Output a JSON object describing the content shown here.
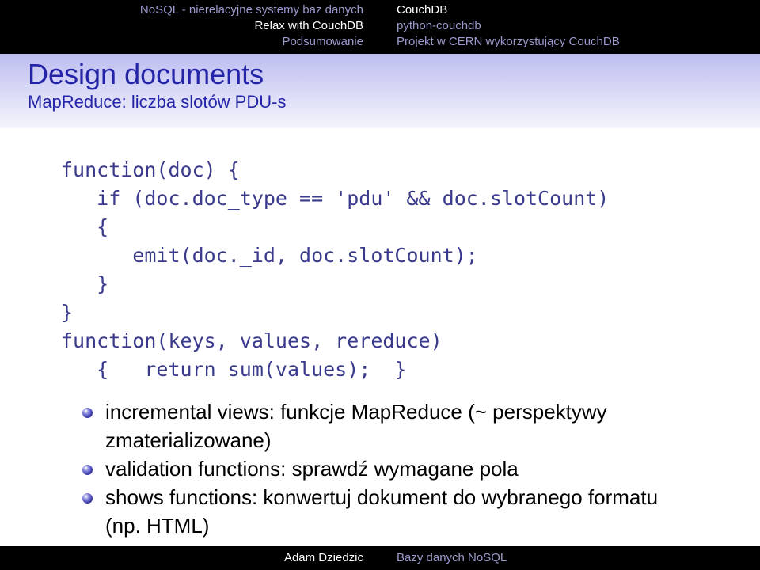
{
  "header": {
    "sections": [
      {
        "label": "NoSQL - nierelacyjne systemy baz danych",
        "active": false
      },
      {
        "label": "Relax with CouchDB",
        "active": true
      },
      {
        "label": "Podsumowanie",
        "active": false
      }
    ],
    "subsections": [
      {
        "label": "CouchDB",
        "active": true
      },
      {
        "label": "python-couchdb",
        "active": false
      },
      {
        "label": "Projekt w CERN wykorzystujący CouchDB",
        "active": false
      }
    ]
  },
  "frame": {
    "title": "Design documents",
    "subtitle": "MapReduce: liczba slotów PDU-s"
  },
  "code": {
    "lines": [
      "function(doc) {",
      "   if (doc.doc_type == 'pdu' && doc.slotCount)",
      "   {",
      "      emit(doc._id, doc.slotCount);",
      "   }",
      "}",
      "function(keys, values, rereduce)",
      "   {   return sum(values);  }"
    ]
  },
  "bullets": [
    "incremental views: funkcje MapReduce (~ perspektywy zmaterializowane)",
    "validation functions: sprawdź wymagane pola",
    "shows functions: konwertuj dokument do wybranego formatu (np. HTML)"
  ],
  "footer": {
    "author": "Adam Dziedzic",
    "title": "Bazy danych NoSQL"
  },
  "colors": {
    "header_background": "#000000",
    "title_text": "#2424a8",
    "code_text": "#3a3a8c",
    "nav_inactive": "#9a9acd",
    "nav_active": "#ffffff"
  }
}
